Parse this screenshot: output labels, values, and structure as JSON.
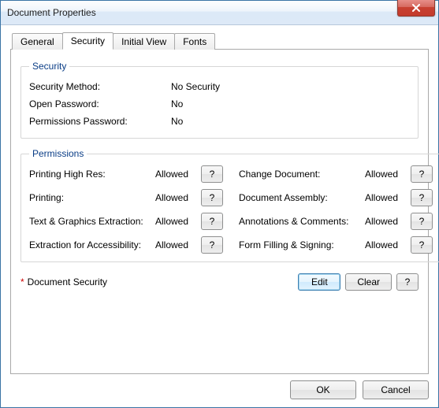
{
  "window": {
    "title": "Document Properties"
  },
  "tabs": {
    "general": "General",
    "security": "Security",
    "initial_view": "Initial View",
    "fonts": "Fonts"
  },
  "security_group": {
    "legend": "Security",
    "rows": {
      "method_label": "Security Method:",
      "method_value": "No Security",
      "open_pw_label": "Open Password:",
      "open_pw_value": "No",
      "perm_pw_label": "Permissions Password:",
      "perm_pw_value": "No"
    }
  },
  "permissions_group": {
    "legend": "Permissions",
    "q": "?",
    "left": [
      {
        "label": "Printing High Res:",
        "value": "Allowed"
      },
      {
        "label": "Printing:",
        "value": "Allowed"
      },
      {
        "label": "Text & Graphics Extraction:",
        "value": "Allowed"
      },
      {
        "label": "Extraction for Accessibility:",
        "value": "Allowed"
      }
    ],
    "right": [
      {
        "label": "Change Document:",
        "value": "Allowed"
      },
      {
        "label": "Document Assembly:",
        "value": "Allowed"
      },
      {
        "label": "Annotations & Comments:",
        "value": "Allowed"
      },
      {
        "label": "Form Filling & Signing:",
        "value": "Allowed"
      }
    ]
  },
  "docsec": {
    "asterisk": "*",
    "label": "Document Security",
    "edit": "Edit",
    "clear": "Clear",
    "help": "?"
  },
  "footer": {
    "ok": "OK",
    "cancel": "Cancel"
  }
}
